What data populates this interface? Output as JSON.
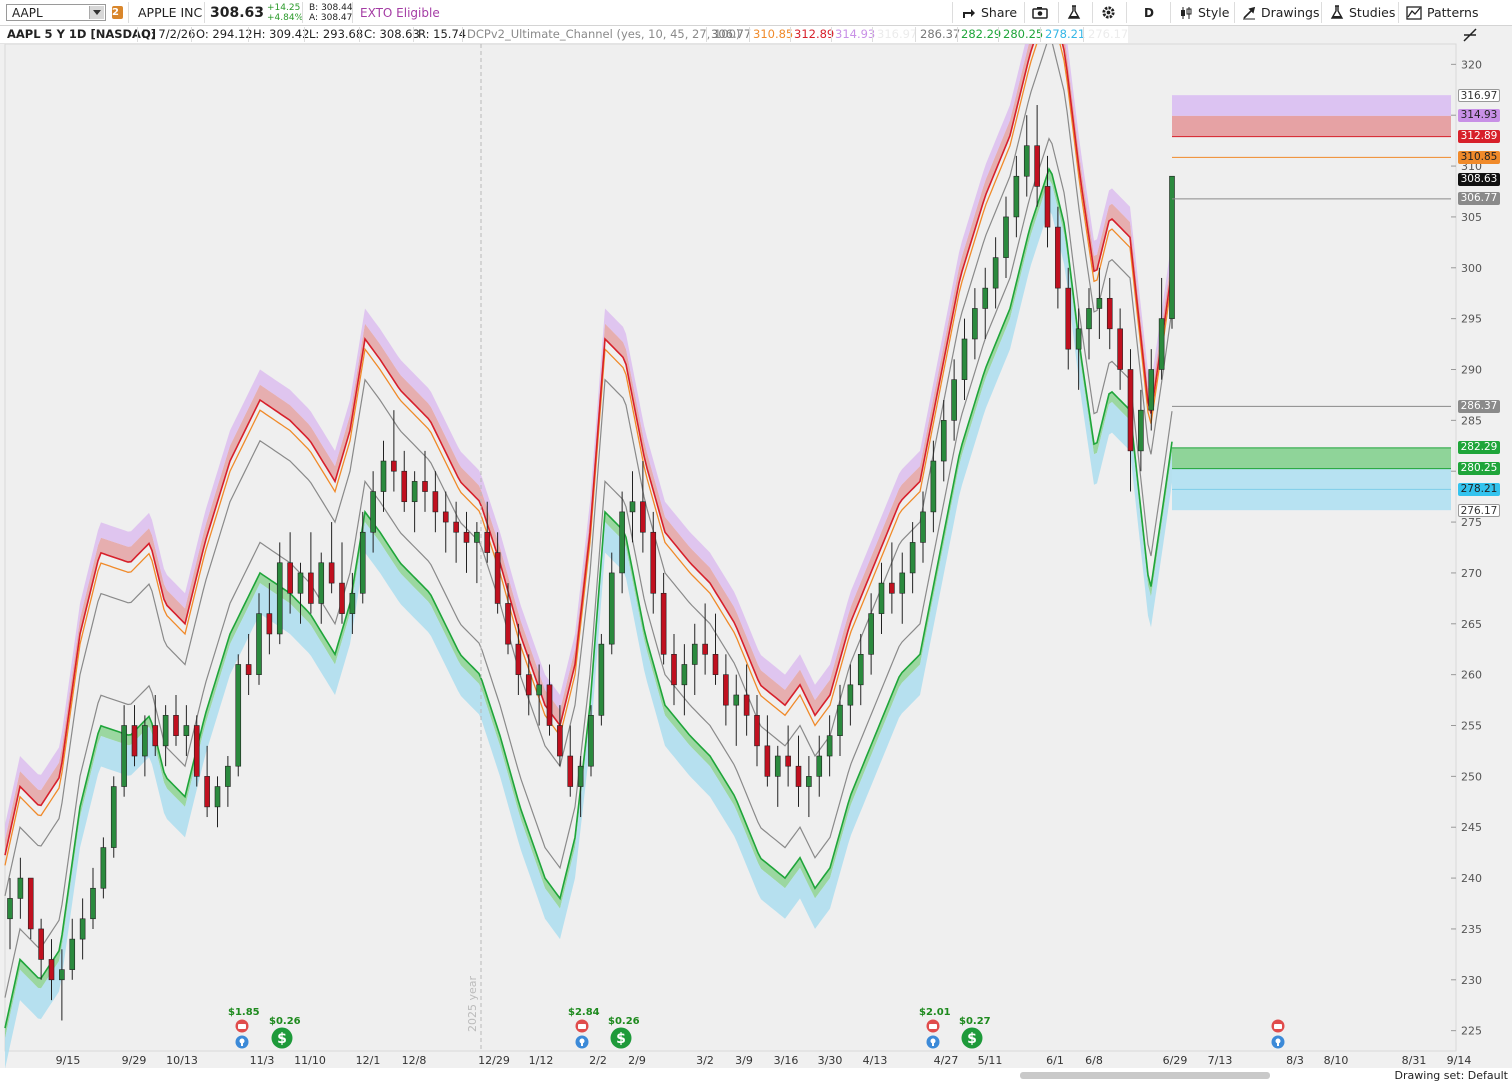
{
  "toolbar": {
    "symbol": "AAPL",
    "tab_count": "2",
    "company": "APPLE INC",
    "last": "308.63",
    "change": "+14.25",
    "change_pct": "+4.84%",
    "bid": "B: 308.44",
    "ask": "A: 308.47",
    "exto": "EXTO Eligible",
    "share": "Share",
    "aggregation": "D",
    "style": "Style",
    "drawings": "Drawings",
    "studies": "Studies",
    "patterns": "Patterns"
  },
  "info": {
    "title": "AAPL 5 Y 1D [NASDAQ]",
    "date": "D: 7/2/26",
    "open": "O: 294.12",
    "high": "H: 309.42",
    "low": "L: 293.68",
    "close": "C: 308.63",
    "range": "R: 15.74",
    "study": "DCPv2_Ultimate_Channel (yes, 10, 45, 27, 100)",
    "study_values": [
      "306.77",
      "310.85",
      "312.89",
      "314.93",
      "316.97",
      "286.37",
      "282.29",
      "280.25",
      "278.21",
      "276.17"
    ]
  },
  "colors": {
    "up": "#2b8a3e",
    "down": "#c0101f",
    "red": "#d7202a",
    "orange": "#f08a2a",
    "purple": "#c890e6",
    "gray": "#8a8a8a",
    "green": "#1fa53a",
    "cyan": "#7ecde8"
  },
  "chart_data": {
    "type": "candlestick",
    "ylim": [
      223,
      322
    ],
    "y_ticks": [
      225,
      230,
      235,
      240,
      245,
      250,
      255,
      260,
      265,
      270,
      275,
      280,
      285,
      290,
      295,
      300,
      305,
      310,
      315,
      320
    ],
    "x_labels": [
      "9/15",
      "9/29",
      "10/13",
      "11/3",
      "11/10",
      "12/1",
      "12/8",
      "12/29",
      "1/12",
      "2/2",
      "2/9",
      "3/2",
      "3/9",
      "3/16",
      "3/30",
      "4/13",
      "4/27",
      "5/11",
      "6/1",
      "6/8",
      "6/29",
      "7/13",
      "8/3",
      "8/10",
      "8/31",
      "9/14"
    ],
    "year_label": "2025 year",
    "price_labels": [
      {
        "value": 316.97,
        "style": "outline"
      },
      {
        "value": 314.93,
        "style": "purple"
      },
      {
        "value": 312.89,
        "style": "red"
      },
      {
        "value": 310.85,
        "style": "orange"
      },
      {
        "value": 308.63,
        "style": "black"
      },
      {
        "value": 306.77,
        "style": "gray"
      },
      {
        "value": 286.37,
        "style": "gray"
      },
      {
        "value": 282.29,
        "style": "green"
      },
      {
        "value": 280.25,
        "style": "green"
      },
      {
        "value": 278.21,
        "style": "cyan"
      },
      {
        "value": 276.17,
        "style": "outline"
      }
    ],
    "channel_mid": [
      [
        0,
        231
      ],
      [
        20,
        240
      ],
      [
        40,
        238
      ],
      [
        60,
        241
      ],
      [
        80,
        255
      ],
      [
        100,
        263
      ],
      [
        130,
        262
      ],
      [
        150,
        264
      ],
      [
        165,
        258
      ],
      [
        185,
        256
      ],
      [
        205,
        264
      ],
      [
        230,
        272
      ],
      [
        260,
        278
      ],
      [
        290,
        276
      ],
      [
        310,
        274
      ],
      [
        335,
        270
      ],
      [
        350,
        275
      ],
      [
        365,
        284
      ],
      [
        380,
        282
      ],
      [
        400,
        279
      ],
      [
        430,
        276
      ],
      [
        460,
        270
      ],
      [
        480,
        268
      ],
      [
        500,
        262
      ],
      [
        520,
        255
      ],
      [
        545,
        248
      ],
      [
        560,
        246
      ],
      [
        575,
        252
      ],
      [
        590,
        265
      ],
      [
        605,
        284
      ],
      [
        625,
        282
      ],
      [
        645,
        272
      ],
      [
        665,
        265
      ],
      [
        690,
        262
      ],
      [
        710,
        260
      ],
      [
        735,
        256
      ],
      [
        760,
        250
      ],
      [
        785,
        248
      ],
      [
        800,
        250
      ],
      [
        815,
        247
      ],
      [
        830,
        249
      ],
      [
        850,
        256
      ],
      [
        875,
        262
      ],
      [
        900,
        268
      ],
      [
        920,
        270
      ],
      [
        940,
        280
      ],
      [
        960,
        290
      ],
      [
        985,
        298
      ],
      [
        1010,
        304
      ],
      [
        1030,
        312
      ],
      [
        1050,
        318
      ],
      [
        1065,
        312
      ],
      [
        1080,
        300
      ],
      [
        1095,
        290
      ],
      [
        1110,
        296
      ],
      [
        1130,
        294
      ],
      [
        1150,
        276
      ],
      [
        1165,
        286
      ],
      [
        1175,
        293
      ]
    ],
    "ohlc": [
      [
        236,
        240,
        233,
        238
      ],
      [
        238,
        242,
        236,
        240
      ],
      [
        240,
        239,
        234,
        235
      ],
      [
        235,
        236,
        230,
        232
      ],
      [
        232,
        234,
        228,
        230
      ],
      [
        230,
        233,
        226,
        231
      ],
      [
        231,
        236,
        230,
        234
      ],
      [
        234,
        238,
        232,
        236
      ],
      [
        236,
        241,
        235,
        239
      ],
      [
        239,
        244,
        238,
        243
      ],
      [
        243,
        250,
        242,
        249
      ],
      [
        249,
        257,
        248,
        255
      ],
      [
        255,
        257,
        251,
        252
      ],
      [
        252,
        256,
        250,
        255
      ],
      [
        255,
        258,
        252,
        253
      ],
      [
        253,
        257,
        251,
        256
      ],
      [
        256,
        258,
        253,
        254
      ],
      [
        254,
        257,
        252,
        255
      ],
      [
        255,
        256,
        249,
        250
      ],
      [
        250,
        253,
        246,
        247
      ],
      [
        247,
        250,
        245,
        249
      ],
      [
        249,
        252,
        247,
        251
      ],
      [
        251,
        262,
        250,
        261
      ],
      [
        261,
        264,
        258,
        260
      ],
      [
        260,
        268,
        259,
        266
      ],
      [
        266,
        269,
        262,
        264
      ],
      [
        264,
        273,
        263,
        271
      ],
      [
        271,
        274,
        266,
        268
      ],
      [
        268,
        271,
        265,
        270
      ],
      [
        270,
        274,
        266,
        267
      ],
      [
        267,
        272,
        265,
        271
      ],
      [
        271,
        275,
        268,
        269
      ],
      [
        269,
        273,
        265,
        266
      ],
      [
        266,
        270,
        264,
        268
      ],
      [
        268,
        276,
        267,
        274
      ],
      [
        274,
        280,
        272,
        278
      ],
      [
        278,
        283,
        276,
        281
      ],
      [
        281,
        286,
        278,
        280
      ],
      [
        280,
        282,
        276,
        277
      ],
      [
        277,
        280,
        274,
        279
      ],
      [
        279,
        282,
        276,
        278
      ],
      [
        278,
        280,
        274,
        276
      ],
      [
        276,
        278,
        272,
        275
      ],
      [
        275,
        277,
        271,
        274
      ],
      [
        274,
        276,
        270,
        273
      ],
      [
        273,
        275,
        269,
        274
      ],
      [
        274,
        277,
        271,
        272
      ],
      [
        272,
        274,
        266,
        267
      ],
      [
        267,
        269,
        262,
        263
      ],
      [
        263,
        265,
        258,
        260
      ],
      [
        260,
        262,
        256,
        258
      ],
      [
        258,
        261,
        255,
        259
      ],
      [
        259,
        261,
        254,
        255
      ],
      [
        255,
        257,
        251,
        252
      ],
      [
        252,
        255,
        248,
        249
      ],
      [
        249,
        252,
        246,
        251
      ],
      [
        251,
        257,
        250,
        256
      ],
      [
        256,
        264,
        255,
        263
      ],
      [
        263,
        272,
        262,
        270
      ],
      [
        270,
        278,
        268,
        276
      ],
      [
        276,
        280,
        273,
        277
      ],
      [
        277,
        281,
        272,
        274
      ],
      [
        274,
        276,
        266,
        268
      ],
      [
        268,
        270,
        261,
        262
      ],
      [
        262,
        264,
        257,
        259
      ],
      [
        259,
        263,
        256,
        261
      ],
      [
        261,
        265,
        258,
        263
      ],
      [
        263,
        267,
        260,
        262
      ],
      [
        262,
        266,
        259,
        260
      ],
      [
        260,
        262,
        255,
        257
      ],
      [
        257,
        260,
        253,
        258
      ],
      [
        258,
        261,
        254,
        256
      ],
      [
        256,
        258,
        251,
        253
      ],
      [
        253,
        256,
        249,
        250
      ],
      [
        250,
        253,
        247,
        252
      ],
      [
        252,
        255,
        249,
        251
      ],
      [
        251,
        254,
        247,
        249
      ],
      [
        249,
        252,
        246,
        250
      ],
      [
        250,
        254,
        248,
        252
      ],
      [
        252,
        256,
        250,
        254
      ],
      [
        254,
        259,
        252,
        257
      ],
      [
        257,
        261,
        255,
        259
      ],
      [
        259,
        264,
        257,
        262
      ],
      [
        262,
        268,
        260,
        266
      ],
      [
        266,
        271,
        264,
        269
      ],
      [
        269,
        273,
        266,
        268
      ],
      [
        268,
        272,
        265,
        270
      ],
      [
        270,
        275,
        268,
        273
      ],
      [
        273,
        278,
        271,
        276
      ],
      [
        276,
        283,
        274,
        281
      ],
      [
        281,
        287,
        279,
        285
      ],
      [
        285,
        291,
        283,
        289
      ],
      [
        289,
        295,
        287,
        293
      ],
      [
        293,
        298,
        291,
        296
      ],
      [
        296,
        300,
        293,
        298
      ],
      [
        298,
        303,
        296,
        301
      ],
      [
        301,
        307,
        299,
        305
      ],
      [
        305,
        311,
        303,
        309
      ],
      [
        309,
        315,
        307,
        312
      ],
      [
        312,
        316,
        306,
        308
      ],
      [
        308,
        311,
        302,
        304
      ],
      [
        304,
        306,
        296,
        298
      ],
      [
        298,
        300,
        290,
        292
      ],
      [
        292,
        296,
        288,
        294
      ],
      [
        294,
        298,
        291,
        296
      ],
      [
        296,
        300,
        293,
        297
      ],
      [
        297,
        299,
        292,
        294
      ],
      [
        294,
        296,
        288,
        290
      ],
      [
        290,
        292,
        278,
        282
      ],
      [
        282,
        288,
        280,
        286
      ],
      [
        286,
        292,
        284,
        290
      ],
      [
        290,
        299,
        289,
        295
      ],
      [
        295,
        309,
        294,
        309
      ]
    ],
    "events": [
      {
        "div": "$1.85",
        "amt": "$0.26"
      },
      {
        "div": "$2.84",
        "amt": "$0.26"
      },
      {
        "div": "$2.01",
        "amt": "$0.27"
      }
    ]
  },
  "footer": {
    "drawing_set": "Drawing set: Default"
  }
}
